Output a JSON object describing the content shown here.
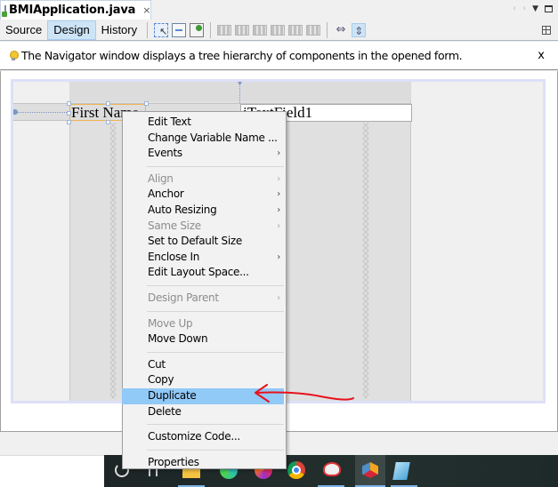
{
  "editor_tab": {
    "title": "BMIApplication.java",
    "close_glyph": "×",
    "file_icon": "java-form-file-icon"
  },
  "tab_nav": {
    "prev": "‹",
    "next": "›",
    "dropdown": "▼"
  },
  "toolbar": {
    "views": [
      {
        "label": "Source",
        "active": false
      },
      {
        "label": "Design",
        "active": true
      },
      {
        "label": "History",
        "active": false
      }
    ],
    "icons": [
      "selection-mode-icon",
      "connection-mode-icon",
      "preview-design-icon",
      "align-left-icon",
      "align-right-icon",
      "center-horizontally-icon",
      "align-top-icon",
      "align-bottom-icon",
      "center-vertically-icon",
      "change-horizontal-resizability-icon",
      "change-vertical-resizability-icon"
    ],
    "hresize_glyph": "⇔",
    "vresize_glyph": "⇕"
  },
  "hint": {
    "text": "The Navigator window displays a tree hierarchy of components in the opened form.",
    "close_label": "x"
  },
  "form": {
    "label_text": "First Name",
    "textfield_text": "jTextField1"
  },
  "context_menu": {
    "items": [
      {
        "label": "Edit Text",
        "disabled": false,
        "submenu": false
      },
      {
        "label": "Change Variable Name ...",
        "disabled": false,
        "submenu": false
      },
      {
        "label": "Events",
        "disabled": false,
        "submenu": true
      },
      {
        "label": "Align",
        "disabled": true,
        "submenu": true
      },
      {
        "label": "Anchor",
        "disabled": false,
        "submenu": true
      },
      {
        "label": "Auto Resizing",
        "disabled": false,
        "submenu": true
      },
      {
        "label": "Same Size",
        "disabled": true,
        "submenu": true
      },
      {
        "label": "Set to Default Size",
        "disabled": false,
        "submenu": false
      },
      {
        "label": "Enclose In",
        "disabled": false,
        "submenu": true
      },
      {
        "label": "Edit Layout Space...",
        "disabled": false,
        "submenu": false
      },
      {
        "label": "Design Parent",
        "disabled": true,
        "submenu": true
      },
      {
        "label": "Move Up",
        "disabled": true,
        "submenu": false
      },
      {
        "label": "Move Down",
        "disabled": false,
        "submenu": false
      },
      {
        "label": "Cut",
        "disabled": false,
        "submenu": false
      },
      {
        "label": "Copy",
        "disabled": false,
        "submenu": false
      },
      {
        "label": "Duplicate",
        "disabled": false,
        "submenu": false,
        "highlighted": true
      },
      {
        "label": "Delete",
        "disabled": false,
        "submenu": false
      },
      {
        "label": "Customize Code...",
        "disabled": false,
        "submenu": false
      },
      {
        "label": "Properties",
        "disabled": false,
        "submenu": false
      }
    ],
    "submenu_glyph": "›"
  },
  "annotation": {
    "color": "#e8121c",
    "points_to": "Duplicate"
  },
  "taskbar": {
    "apps": [
      "search",
      "task-view",
      "file-explorer",
      "edge",
      "firefox",
      "chrome",
      "snipping-tool",
      "netbeans",
      "notepad"
    ],
    "active_app": "netbeans"
  },
  "colors": {
    "menu_highlight": "#91c9f7",
    "active_view": "#cde4f7",
    "selection_border": "#f0b450"
  }
}
